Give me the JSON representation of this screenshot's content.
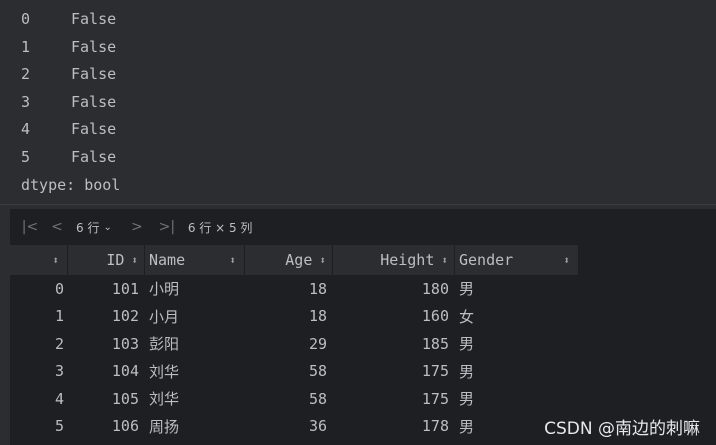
{
  "console": {
    "series_rows": [
      {
        "index": "0",
        "value": "False"
      },
      {
        "index": "1",
        "value": "False"
      },
      {
        "index": "2",
        "value": "False"
      },
      {
        "index": "3",
        "value": "False"
      },
      {
        "index": "4",
        "value": "False"
      },
      {
        "index": "5",
        "value": "False"
      }
    ],
    "dtype_line": "dtype: bool"
  },
  "toolbar": {
    "first_icon": "first-page-icon",
    "prev_icon": "previous-page-icon",
    "rows_label": "6 行",
    "next_icon": "next-page-icon",
    "last_icon": "last-page-icon",
    "summary": "6 行 × 5 列"
  },
  "table": {
    "headers": [
      "ID",
      "Name",
      "Age",
      "Height",
      "Gender"
    ],
    "rows": [
      {
        "index": "0",
        "ID": "101",
        "Name": "小明",
        "Age": "18",
        "Height": "180",
        "Gender": "男"
      },
      {
        "index": "1",
        "ID": "102",
        "Name": "小月",
        "Age": "18",
        "Height": "160",
        "Gender": "女"
      },
      {
        "index": "2",
        "ID": "103",
        "Name": "彭阳",
        "Age": "29",
        "Height": "185",
        "Gender": "男"
      },
      {
        "index": "3",
        "ID": "104",
        "Name": "刘华",
        "Age": "58",
        "Height": "175",
        "Gender": "男"
      },
      {
        "index": "4",
        "ID": "105",
        "Name": "刘华",
        "Age": "58",
        "Height": "175",
        "Gender": "男"
      },
      {
        "index": "5",
        "ID": "106",
        "Name": "周扬",
        "Age": "36",
        "Height": "178",
        "Gender": "男"
      }
    ]
  },
  "watermark": "CSDN @南边的刺嘛"
}
